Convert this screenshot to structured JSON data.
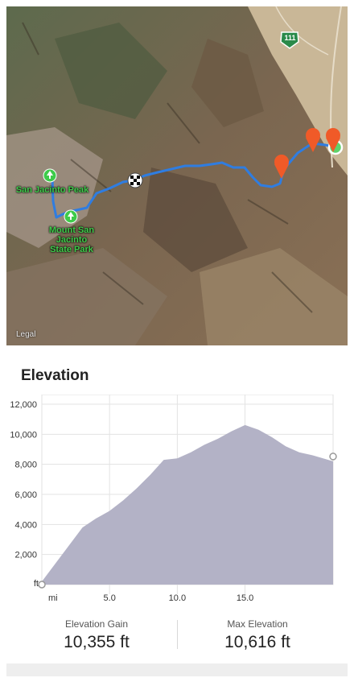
{
  "map": {
    "highway_shield": "111",
    "poi_peak": "San Jacinto Peak",
    "poi_park_line1": "Mount San",
    "poi_park_line2": "Jacinto",
    "poi_park_line3": "State Park",
    "legal": "Legal",
    "colors": {
      "route": "#2f7de1",
      "marker": "#f05a28",
      "start": "#5fd36b",
      "poi": "#3ecb4a"
    }
  },
  "elevation": {
    "title": "Elevation",
    "gain_label": "Elevation Gain",
    "gain_value": "10,355 ft",
    "max_label": "Max Elevation",
    "max_value": "10,616 ft"
  },
  "chart_data": {
    "type": "area",
    "title": "Elevation",
    "ylabel": "ft",
    "xlabel": "mi",
    "ylim": [
      0,
      12000
    ],
    "xlim": [
      0,
      21.5
    ],
    "y_ticks": [
      2000,
      4000,
      6000,
      8000,
      10000,
      12000
    ],
    "y_tick_labels": [
      "2,000",
      "4,000",
      "6,000",
      "8,000",
      "10,000",
      "12,000"
    ],
    "x_ticks": [
      5,
      10,
      15
    ],
    "x_tick_labels": [
      "5.0",
      "10.0",
      "15.0"
    ],
    "x": [
      0,
      1,
      2,
      3,
      4,
      5,
      6,
      7,
      8,
      9,
      10,
      11,
      12,
      13,
      14,
      15,
      16,
      17,
      18,
      19,
      20,
      21.5
    ],
    "values": [
      200,
      1400,
      2600,
      3800,
      4400,
      4900,
      5600,
      6400,
      7300,
      8300,
      8400,
      8800,
      9300,
      9700,
      10200,
      10616,
      10300,
      9800,
      9200,
      8800,
      8600,
      8200
    ],
    "grid": true,
    "color": "#b3b2c6"
  }
}
